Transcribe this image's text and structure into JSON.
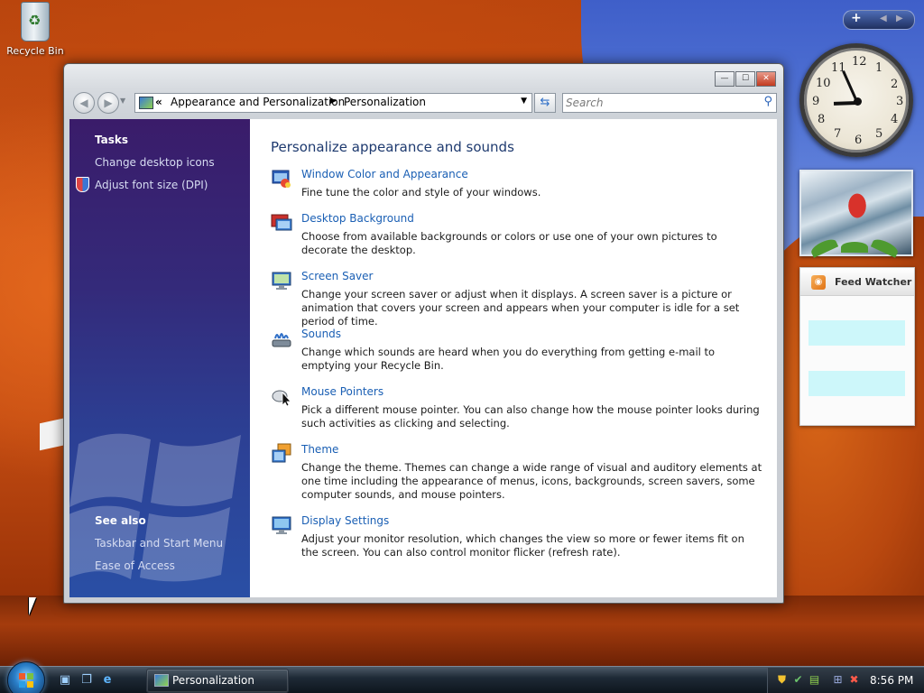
{
  "desktop": {
    "recycle_bin_label": "Recycle Bin"
  },
  "window": {
    "title_buttons": {
      "minimize": "—",
      "maximize": "☐",
      "close": "✕"
    },
    "breadcrumb": {
      "chevron": "«",
      "items": [
        "Appearance and Personalization",
        "Personalization"
      ],
      "separator": "▶"
    },
    "search": {
      "placeholder": "Search"
    }
  },
  "sidebar": {
    "tasks_heading": "Tasks",
    "tasks": [
      {
        "label": "Change desktop icons"
      },
      {
        "label": "Adjust font size (DPI)"
      }
    ],
    "see_also_heading": "See also",
    "see_also": [
      {
        "label": "Taskbar and Start Menu"
      },
      {
        "label": "Ease of Access"
      }
    ]
  },
  "content": {
    "title": "Personalize appearance and sounds",
    "items": [
      {
        "icon": "window-color-icon",
        "title": "Window Color and Appearance",
        "desc": "Fine tune the color and style of your windows."
      },
      {
        "icon": "desktop-background-icon",
        "title": "Desktop Background",
        "desc": "Choose from available backgrounds or colors or use one of your own pictures to decorate the desktop."
      },
      {
        "icon": "screen-saver-icon",
        "title": "Screen Saver",
        "desc": "Change your screen saver or adjust when it displays. A screen saver is a picture or animation that covers your screen and appears when your computer is idle for a set period of time."
      },
      {
        "icon": "sounds-icon",
        "title": "Sounds",
        "desc": "Change which sounds are heard when you do everything from getting e-mail to emptying your Recycle Bin."
      },
      {
        "icon": "mouse-pointers-icon",
        "title": "Mouse Pointers",
        "desc": "Pick a different mouse pointer. You can also change how the mouse pointer looks during such activities as clicking and selecting."
      },
      {
        "icon": "theme-icon",
        "title": "Theme",
        "desc": "Change the theme. Themes can change a wide range of visual and auditory elements at one time including the appearance of menus, icons, backgrounds, screen savers, some computer sounds, and mouse pointers."
      },
      {
        "icon": "display-settings-icon",
        "title": "Display Settings",
        "desc": "Adjust your monitor resolution, which changes the view so more or fewer items fit on the screen. You can also control monitor flicker (refresh rate)."
      }
    ]
  },
  "gadgets": {
    "toolbar": {
      "add": "+",
      "prev": "◀",
      "next": "▶"
    },
    "clock": {
      "numbers": [
        "12",
        "1",
        "2",
        "3",
        "4",
        "5",
        "6",
        "7",
        "8",
        "9",
        "10",
        "11"
      ],
      "hour": 8,
      "minute": 56
    },
    "feed_watcher_title": "Feed Watcher"
  },
  "taskbar": {
    "task_button_label": "Personalization",
    "clock": "8:56 PM"
  },
  "colors": {
    "link": "#1a5fb4",
    "sidebar_top": "#3a1c6a",
    "sidebar_bottom": "#2a4fa5",
    "content_title": "#1e3a6f"
  }
}
